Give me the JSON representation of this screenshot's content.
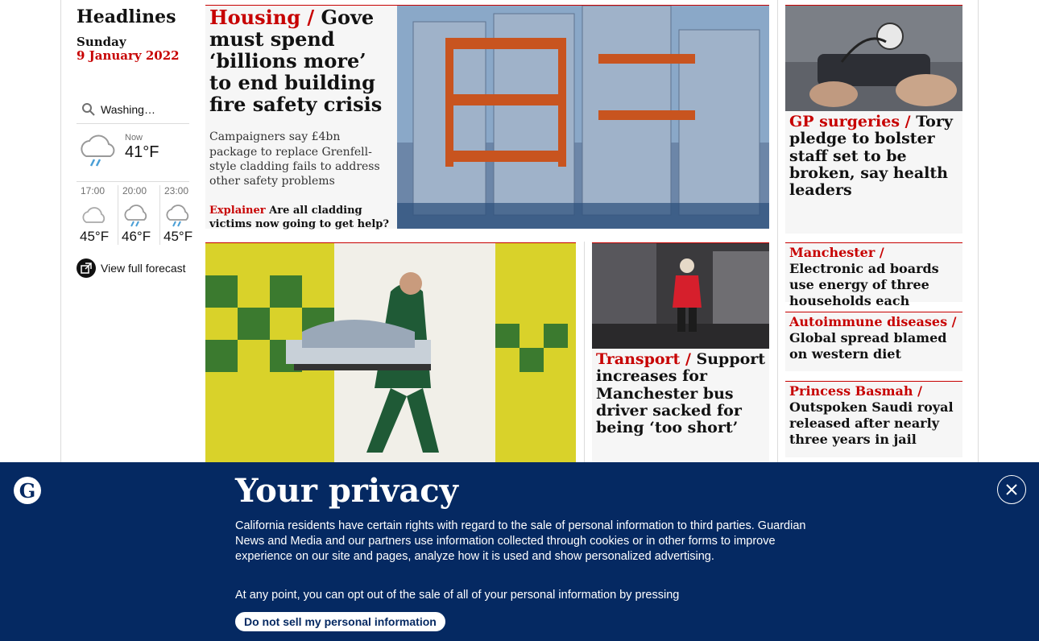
{
  "sidebar": {
    "section_title": "Headlines",
    "day": "Sunday",
    "date": "9 January 2022",
    "search_value": "Washing…",
    "now_label": "Now",
    "now_temp": "41°F",
    "forecast": [
      {
        "time": "17:00",
        "temp": "45°F",
        "icon": "cloud-icon"
      },
      {
        "time": "20:00",
        "temp": "46°F",
        "icon": "rain-cloud-icon"
      },
      {
        "time": "23:00",
        "temp": "45°F",
        "icon": "rain-cloud-icon"
      }
    ],
    "full_forecast_label": "View full forecast"
  },
  "stories": {
    "housing": {
      "kicker": "Housing /",
      "headline": "Gove must spend ‘billions more’ to end building fire safety crisis",
      "standfirst": "Campaigners say £4bn package to replace Grenfell-style cladding fails to address other safety problems",
      "explainer_kicker": "Explainer",
      "explainer_text": "Are all cladding victims now going to get help?"
    },
    "gp": {
      "kicker": "GP surgeries /",
      "headline": "Tory pledge to bolster staff set to be broken, say health leaders"
    },
    "transport": {
      "kicker": "Transport /",
      "headline": "Support increases for Manchester bus driver sacked for being ‘too short’"
    },
    "manchester": {
      "kicker": "Manchester /",
      "headline": "Electronic ad boards use energy of three households each"
    },
    "autoimmune": {
      "kicker": "Autoimmune diseases /",
      "headline": "Global spread blamed on western diet"
    },
    "basmah": {
      "kicker": "Princess Basmah /",
      "headline": "Outspoken Saudi royal released after nearly three years in jail"
    }
  },
  "privacy": {
    "title": "Your privacy",
    "body": "California residents have certain rights with regard to the sale of personal information to third parties. Guardian News and Media and our partners use information collected through cookies or in other forms to improve experience on our site and pages, analyze how it is used and show personalized advertising.",
    "optout": "At any point, you can opt out of the sale of all of your personal information by pressing",
    "button_label": "Do not sell my personal information"
  },
  "colors": {
    "accent": "#c70000",
    "banner": "#052962"
  }
}
